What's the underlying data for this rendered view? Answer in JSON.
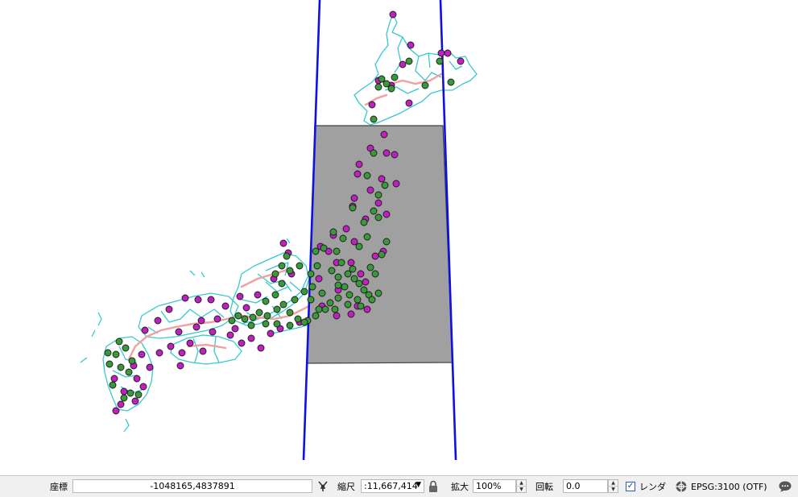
{
  "map": {
    "colors": {
      "outline": "#38c8d0",
      "road": "#f0a0a0",
      "point_magenta": "#c020c0",
      "point_green": "#3a9a3a",
      "extent_fill": "#a0a0a0",
      "guide_line": "#1010e0"
    }
  },
  "statusbar": {
    "coordinate_label": "座標",
    "coordinate_value": "-1048165,4837891",
    "toggle_icon": "mouse-pointer-toggle-icon",
    "scale_label": "縮尺",
    "scale_value": ":11,667,414",
    "lock_icon": "lock-icon",
    "magnifier_label": "拡大",
    "magnifier_value": "100%",
    "rotation_label": "回転",
    "rotation_value": "0.0",
    "render_checked": "✓",
    "render_label": "レンダ",
    "crs_icon": "projection-globe-icon",
    "crs_value": "EPSG:3100 (OTF)",
    "messages_icon": "speech-bubble-icon"
  }
}
